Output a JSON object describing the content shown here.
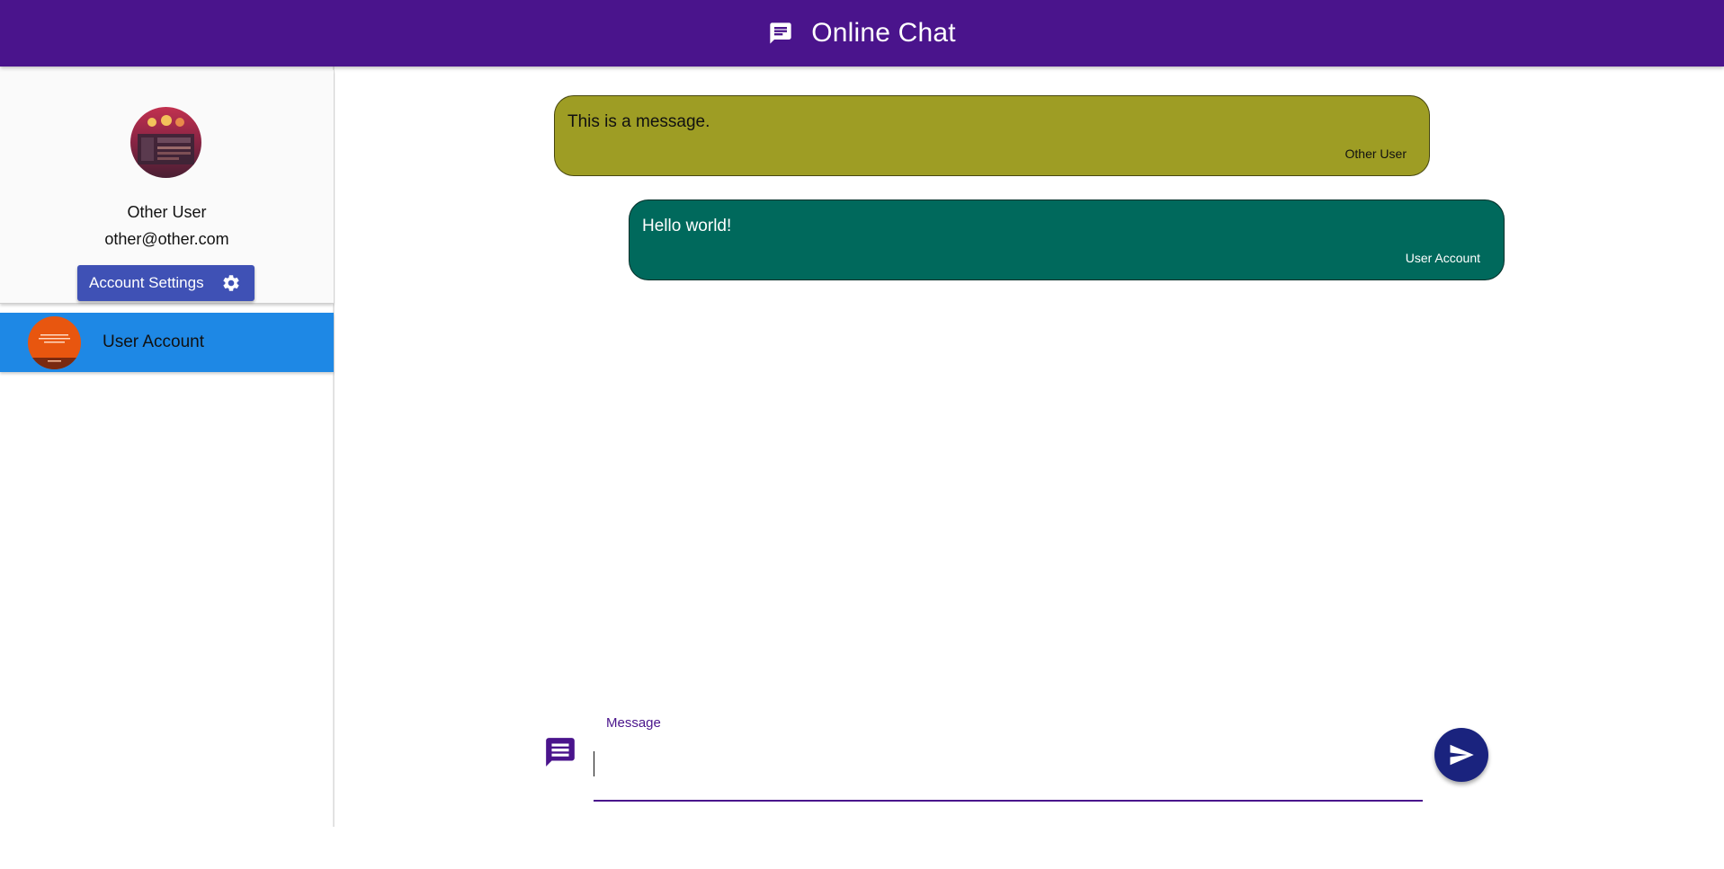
{
  "app_bar": {
    "title": "Online Chat",
    "icon": "chat-icon",
    "background_color": "#4a148c"
  },
  "sidebar": {
    "profile": {
      "name": "Other User",
      "email": "other@other.com",
      "avatar": "profile-avatar",
      "settings_button": {
        "label": "Account Settings",
        "icon": "gear-icon",
        "color": "#3f51b5"
      }
    },
    "contacts": [
      {
        "name": "User Account",
        "avatar": "contact-avatar",
        "selected": true,
        "highlight_color": "#1e88e5"
      }
    ]
  },
  "messages": [
    {
      "text": "This is a message.",
      "author": "Other User",
      "color": "#9e9d24"
    },
    {
      "text": "Hello world!",
      "author": "User Account",
      "color": "#00695c"
    }
  ],
  "composer": {
    "label": "Message",
    "value": "",
    "icon": "message-icon",
    "accent_color": "#4a148c",
    "send_button": {
      "icon": "send-icon",
      "color": "#1a237e"
    }
  }
}
